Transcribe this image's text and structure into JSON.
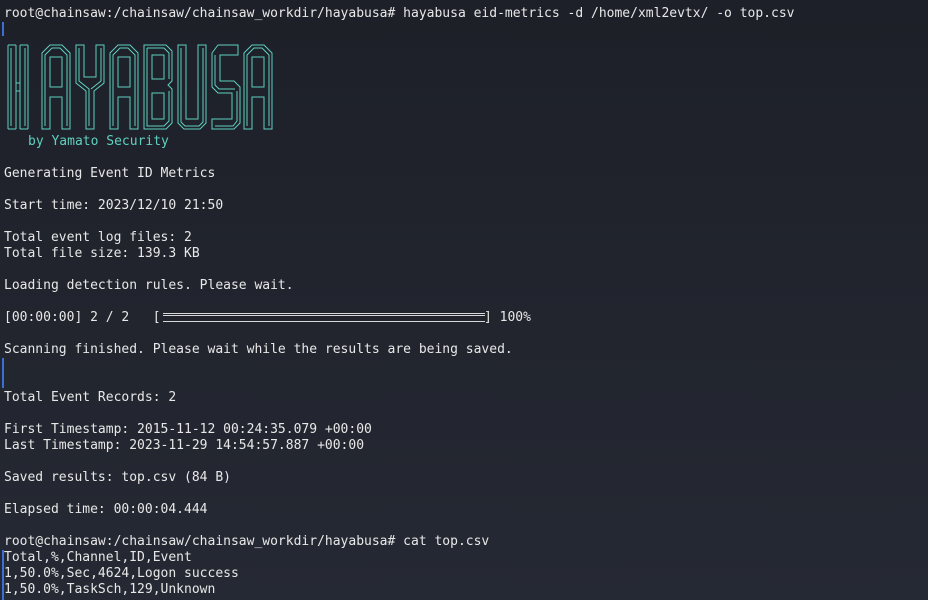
{
  "terminal": {
    "prompt1": "root@chainsaw:/chainsaw/chainsaw_workdir/hayabusa# hayabusa eid-metrics -d /home/xml2evtx/ -o top.csv",
    "logo_text": "HAYABUSA",
    "byline": "by Yamato Security",
    "generating": "Generating Event ID Metrics",
    "start_time": "Start time: 2023/12/10 21:50",
    "total_files": "Total event log files: 2",
    "total_size": "Total file size: 139.3 KB",
    "loading": "Loading detection rules. Please wait.",
    "progress_prefix": "[00:00:00] 2 / 2   [",
    "progress_suffix": "] 100%",
    "progress_fraction": 1.0,
    "scanning": "Scanning finished. Please wait while the results are being saved.",
    "total_records": "Total Event Records: 2",
    "first_ts": "First Timestamp: 2015-11-12 00:24:35.079 +00:00",
    "last_ts": "Last Timestamp: 2023-11-29 14:54:57.887 +00:00",
    "saved": "Saved results: top.csv (84 B)",
    "elapsed": "Elapsed time: 00:00:04.444",
    "prompt2": "root@chainsaw:/chainsaw/chainsaw_workdir/hayabusa# cat top.csv",
    "csv_lines": [
      "Total,%,Channel,ID,Event",
      "1,50.0%,Sec,4624,Logon success",
      "1,50.0%,TaskSch,129,Unknown"
    ]
  },
  "colors": {
    "background": "#21242d",
    "text": "#e8e8e8",
    "logo": "#5fd0c0",
    "cursor_mark": "#3b6fd6"
  }
}
